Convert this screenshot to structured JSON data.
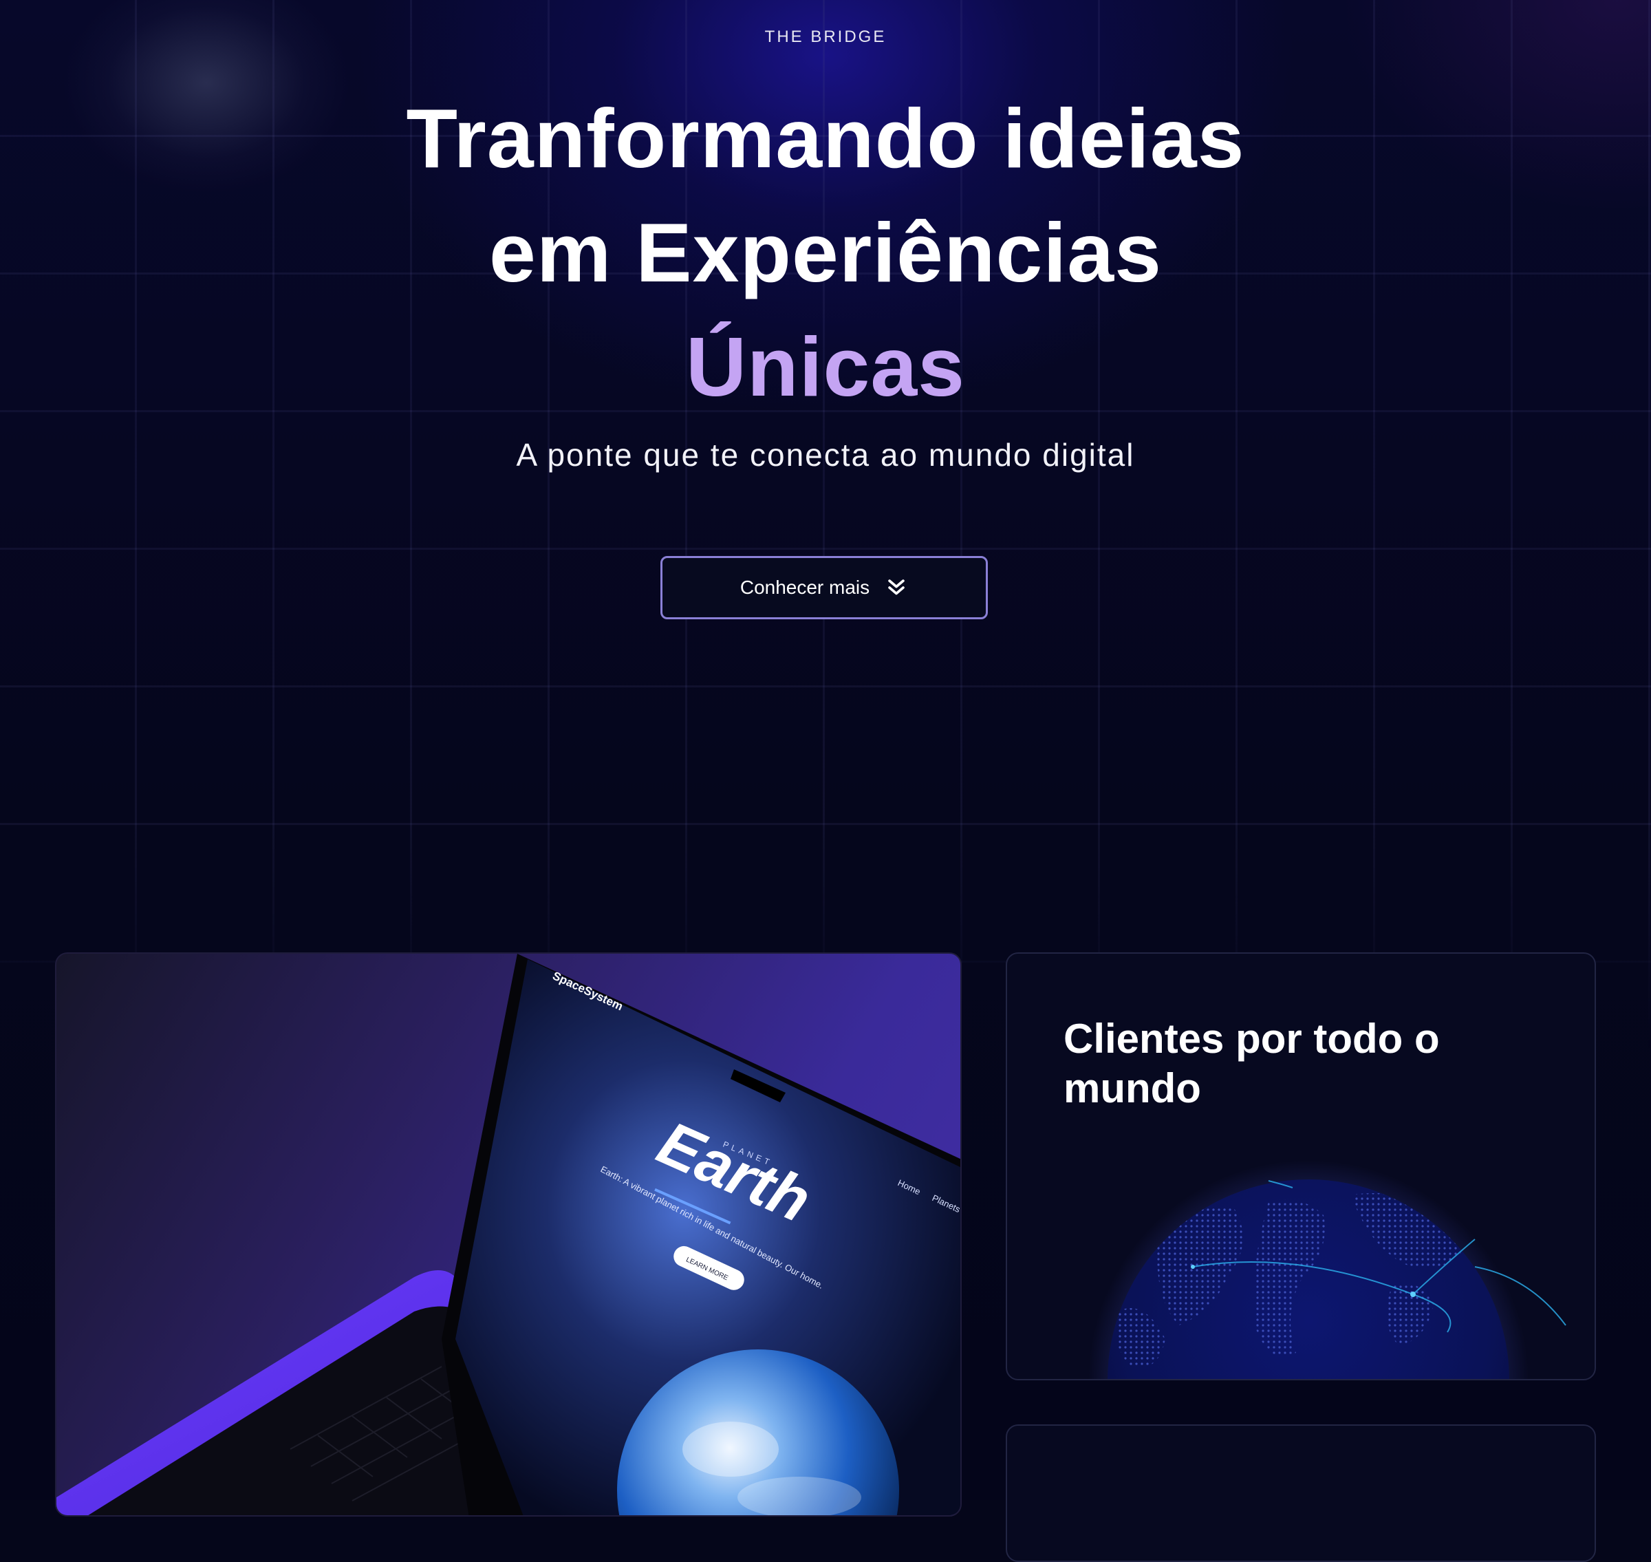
{
  "brand": "THE BRIDGE",
  "hero": {
    "line1": "Tranformando ideias",
    "line2": "em Experiências",
    "line3": "Únicas",
    "subtitle": "A ponte que te conecta ao mundo digital"
  },
  "cta": {
    "label": "Conhecer mais",
    "icon": "double-chevron-down-icon"
  },
  "cards": {
    "globe": {
      "title": "Clientes por todo o mundo"
    },
    "laptop": {
      "site_logo": "SpaceSystem",
      "nav_home": "Home",
      "nav_planets": "Planets",
      "kicker": "PLANET",
      "heading": "Earth",
      "tagline": "Earth: A vibrant planet rich in life and natural beauty. Our home.",
      "button": "LEARN MORE"
    }
  },
  "colors": {
    "background": "#05061a",
    "accent": "#c4a4f3",
    "button_border": "#8a80d6",
    "card_purple": "#4430a8"
  }
}
